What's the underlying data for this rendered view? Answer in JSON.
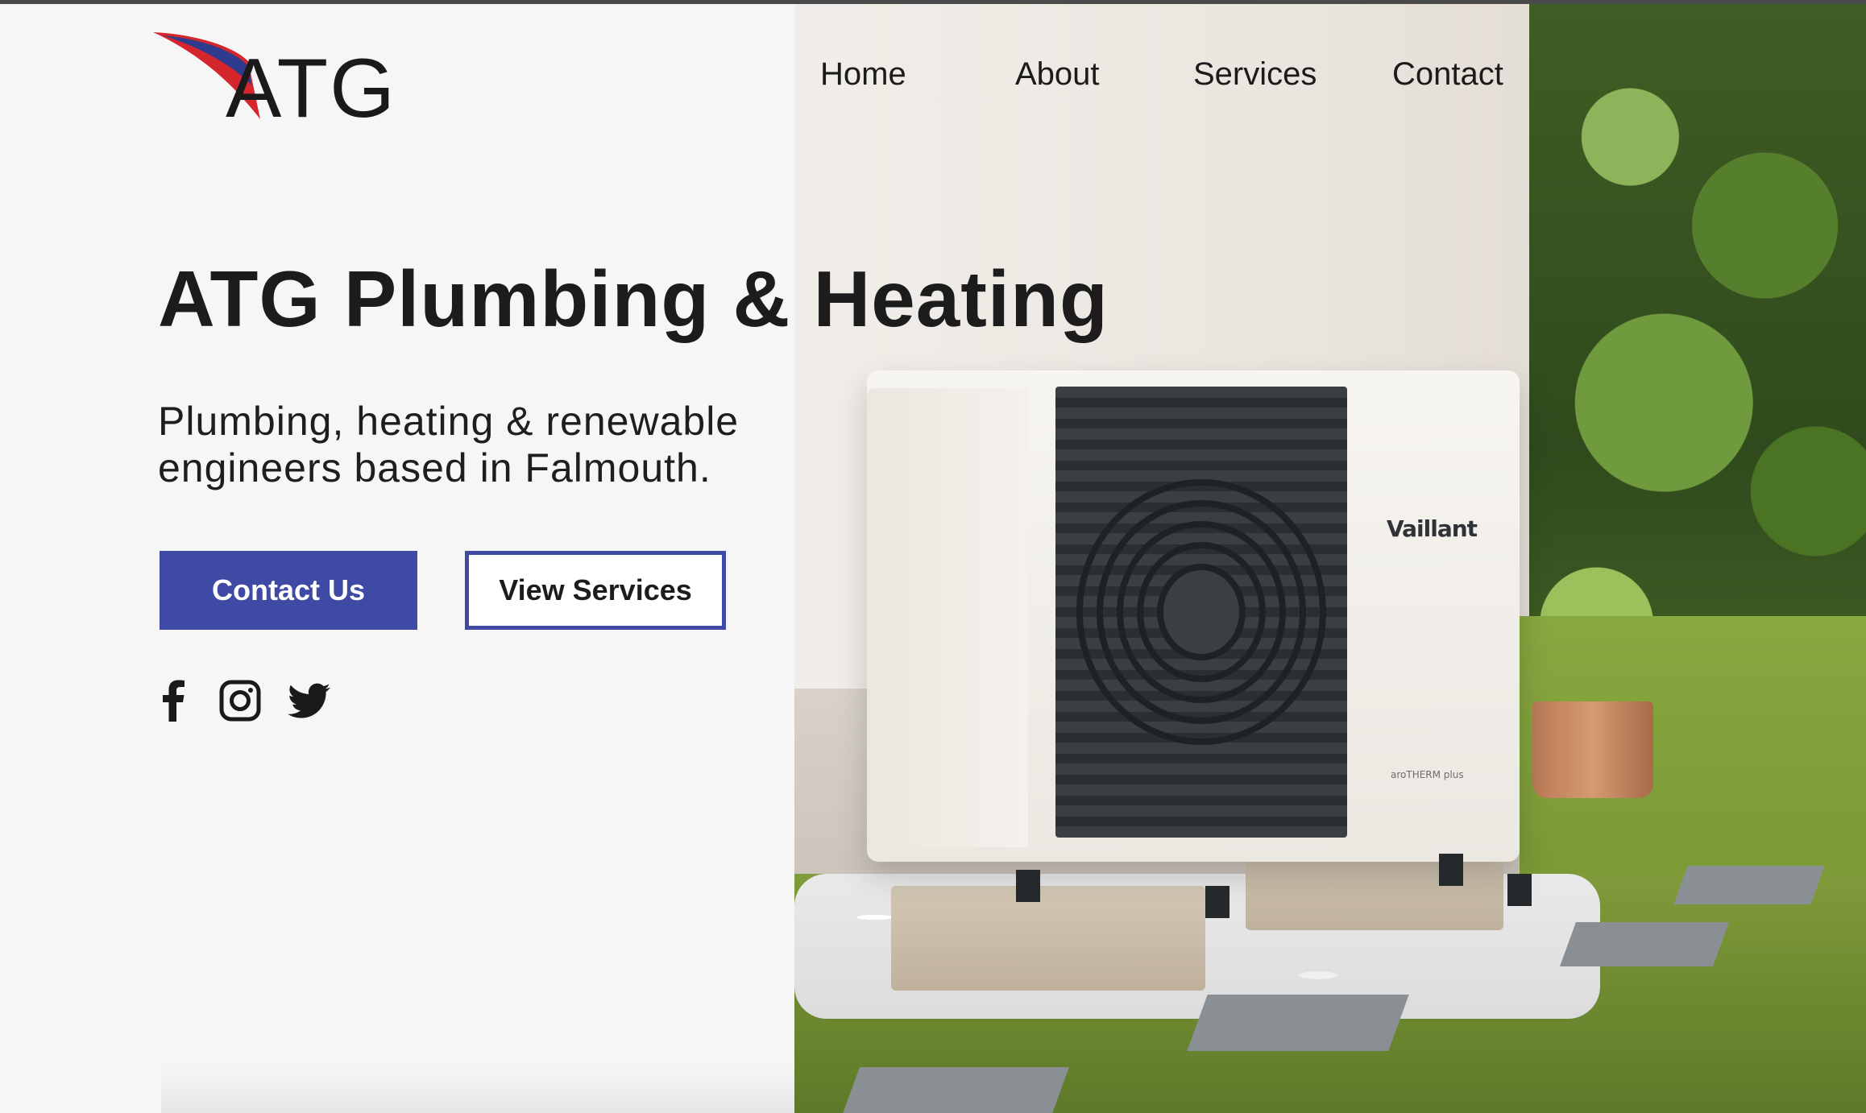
{
  "brand": {
    "logo_text": "ATG",
    "accent_color": "#3f4aa4",
    "swoosh_colors": [
      "#d4262c",
      "#2f3b8f"
    ]
  },
  "nav": {
    "items": [
      {
        "label": "Home"
      },
      {
        "label": "About"
      },
      {
        "label": "Services"
      },
      {
        "label": "Contact"
      }
    ]
  },
  "hero": {
    "title": "ATG Plumbing & Heating",
    "subtitle_line1": "Plumbing, heating & renewable",
    "subtitle_line2": "engineers based in Falmouth.",
    "primary_button": "Contact Us",
    "secondary_button": "View Services"
  },
  "social": {
    "icons": [
      "facebook-icon",
      "instagram-icon",
      "twitter-icon"
    ]
  },
  "photo": {
    "product_brand": "Vaillant",
    "product_model": "aroTHERM plus"
  }
}
